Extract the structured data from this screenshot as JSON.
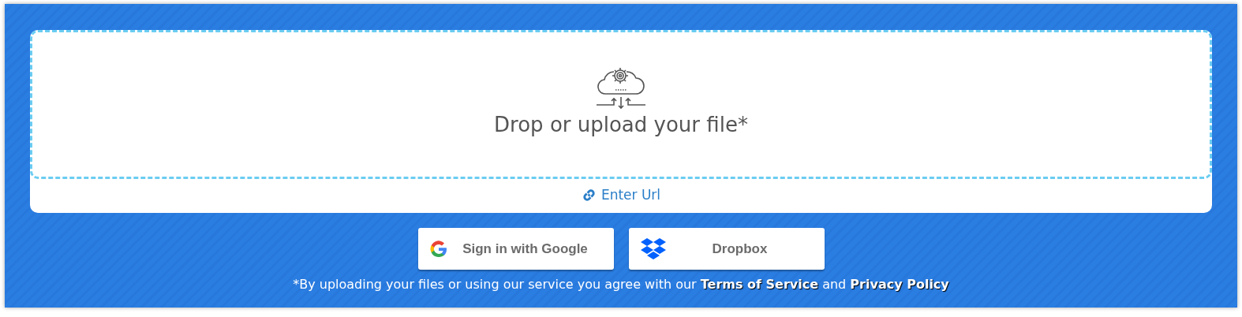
{
  "dropzone": {
    "title": "Drop or upload your file*"
  },
  "url_link": {
    "label": "Enter Url"
  },
  "buttons": [
    {
      "kind": "google",
      "label": "Sign in with Google"
    },
    {
      "kind": "dropbox",
      "label": "Dropbox"
    }
  ],
  "notice": {
    "before": "*By uploading your files or using our service you agree with our",
    "links": [
      "Terms of Service",
      "Privacy Policy"
    ],
    "joiner": "and"
  }
}
